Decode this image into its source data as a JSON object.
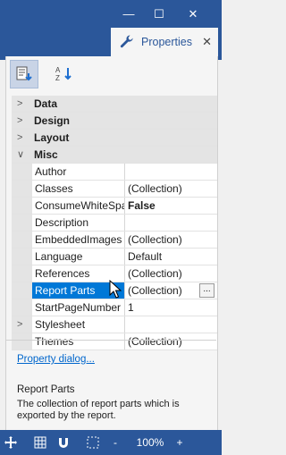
{
  "window": {
    "minimize_glyph": "—",
    "maximize_glyph": "☐",
    "close_glyph": "✕"
  },
  "tab": {
    "icon": "wrench-icon",
    "label": "Properties",
    "close_glyph": "✕"
  },
  "toolbar": {
    "categorized_icon": "categorized-icon",
    "alphabetical_icon": "alphabetical-sort-icon"
  },
  "categories": [
    {
      "label": "Data",
      "expanded": false
    },
    {
      "label": "Design",
      "expanded": false
    },
    {
      "label": "Layout",
      "expanded": false
    },
    {
      "label": "Misc",
      "expanded": true
    }
  ],
  "properties": [
    {
      "name": "Author",
      "value": ""
    },
    {
      "name": "Classes",
      "value": "(Collection)"
    },
    {
      "name": "ConsumeWhiteSpace",
      "value": "False"
    },
    {
      "name": "Description",
      "value": ""
    },
    {
      "name": "EmbeddedImages",
      "value": "(Collection)"
    },
    {
      "name": "Language",
      "value": "Default"
    },
    {
      "name": "References",
      "value": "(Collection)"
    },
    {
      "name": "Report Parts",
      "value": "(Collection)"
    },
    {
      "name": "StartPageNumber",
      "value": "1"
    },
    {
      "name": "Stylesheet",
      "value": ""
    },
    {
      "name": "Themes",
      "value": "(Collection)"
    }
  ],
  "selected_property": "Report Parts",
  "ellipsis_label": "...",
  "property_dialog_link": "Property dialog...",
  "description": {
    "title": "Report Parts",
    "text": "The collection of report parts which is exported by the report."
  },
  "statusbar": {
    "zoom_minus": "-",
    "zoom_level": "100%",
    "zoom_plus": "+"
  },
  "colors": {
    "accent": "#2b579a",
    "selection": "#0078d7"
  }
}
